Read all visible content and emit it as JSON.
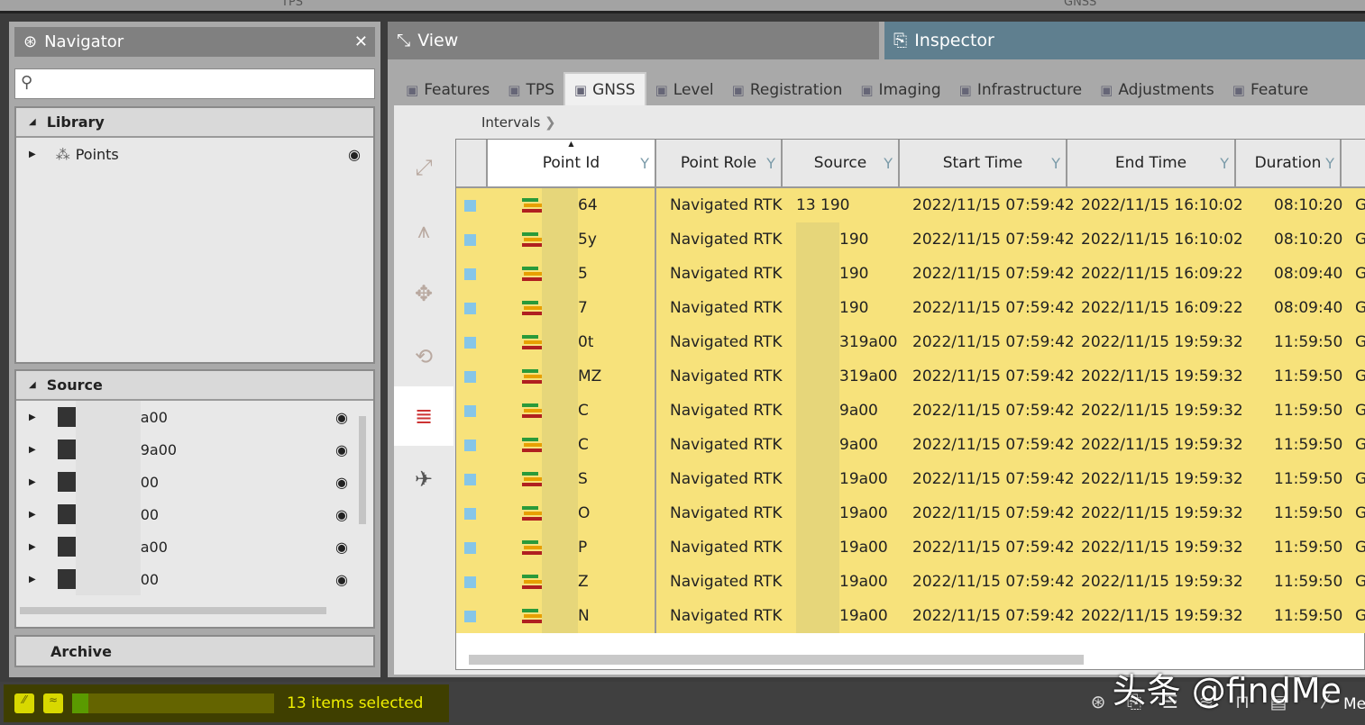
{
  "top": {
    "left": "TPS",
    "right": "GNSS"
  },
  "navigator": {
    "title": "Navigator",
    "search_placeholder": "",
    "library": {
      "title": "Library",
      "items": [
        {
          "label": "Points"
        }
      ]
    },
    "source": {
      "title": "Source",
      "items": [
        "a00",
        "9a00",
        "00",
        "00",
        "a00",
        "00"
      ]
    },
    "archive": "Archive"
  },
  "view": {
    "title": "View"
  },
  "inspector": {
    "title": "Inspector"
  },
  "tabs": [
    {
      "label": "Features",
      "icon": "features-icon"
    },
    {
      "label": "TPS",
      "icon": "tps-icon"
    },
    {
      "label": "GNSS",
      "icon": "satellite-icon",
      "active": true
    },
    {
      "label": "Level",
      "icon": "level-icon"
    },
    {
      "label": "Registration",
      "icon": "registration-icon"
    },
    {
      "label": "Imaging",
      "icon": "image-icon"
    },
    {
      "label": "Infrastructure",
      "icon": "infrastructure-icon"
    },
    {
      "label": "Adjustments",
      "icon": "gear-icon"
    },
    {
      "label": "Feature",
      "icon": "feature-code-icon"
    }
  ],
  "breadcrumb": "Intervals",
  "table": {
    "columns": [
      "Point Id",
      "Point Role",
      "Source",
      "Start Time",
      "End Time",
      "Duration"
    ],
    "rows": [
      [
        "64",
        "Navigated RTK",
        "13  190",
        "2022/11/15 07:59:42",
        "2022/11/15 16:10:02",
        "08:10:20",
        "G"
      ],
      [
        "5y",
        "Navigated RTK",
        "190",
        "2022/11/15 07:59:42",
        "2022/11/15 16:10:02",
        "08:10:20",
        "G"
      ],
      [
        "5",
        "Navigated RTK",
        "190",
        "2022/11/15 07:59:42",
        "2022/11/15 16:09:22",
        "08:09:40",
        "G"
      ],
      [
        "7",
        "Navigated RTK",
        "190",
        "2022/11/15 07:59:42",
        "2022/11/15 16:09:22",
        "08:09:40",
        "G"
      ],
      [
        "0t",
        "Navigated RTK",
        "319a00",
        "2022/11/15 07:59:42",
        "2022/11/15 19:59:32",
        "11:59:50",
        "G"
      ],
      [
        "MZ",
        "Navigated RTK",
        "319a00",
        "2022/11/15 07:59:42",
        "2022/11/15 19:59:32",
        "11:59:50",
        "G"
      ],
      [
        "C",
        "Navigated RTK",
        "9a00",
        "2022/11/15 07:59:42",
        "2022/11/15 19:59:32",
        "11:59:50",
        "G"
      ],
      [
        "C",
        "Navigated RTK",
        "9a00",
        "2022/11/15 07:59:42",
        "2022/11/15 19:59:32",
        "11:59:50",
        "G"
      ],
      [
        "S",
        "Navigated RTK",
        "19a00",
        "2022/11/15 07:59:42",
        "2022/11/15 19:59:32",
        "11:59:50",
        "G"
      ],
      [
        "O",
        "Navigated RTK",
        "19a00",
        "2022/11/15 07:59:42",
        "2022/11/15 19:59:32",
        "11:59:50",
        "G"
      ],
      [
        "P",
        "Navigated RTK",
        "19a00",
        "2022/11/15 07:59:42",
        "2022/11/15 19:59:32",
        "11:59:50",
        "G"
      ],
      [
        "Z",
        "Navigated RTK",
        "19a00",
        "2022/11/15 07:59:42",
        "2022/11/15 19:59:32",
        "11:59:50",
        "G"
      ],
      [
        "N",
        "Navigated RTK",
        "19a00",
        "2022/11/15 07:59:42",
        "2022/11/15 19:59:32",
        "11:59:50",
        "G"
      ]
    ]
  },
  "status": {
    "selection": "13 items selected",
    "progress_percent": 8,
    "watermark": "头条 @findMe",
    "right_label": "Me"
  },
  "colors": {
    "row_selected": "#f7e27b",
    "inspector_header": "#5f7f8f",
    "status_text": "#f0f000"
  }
}
